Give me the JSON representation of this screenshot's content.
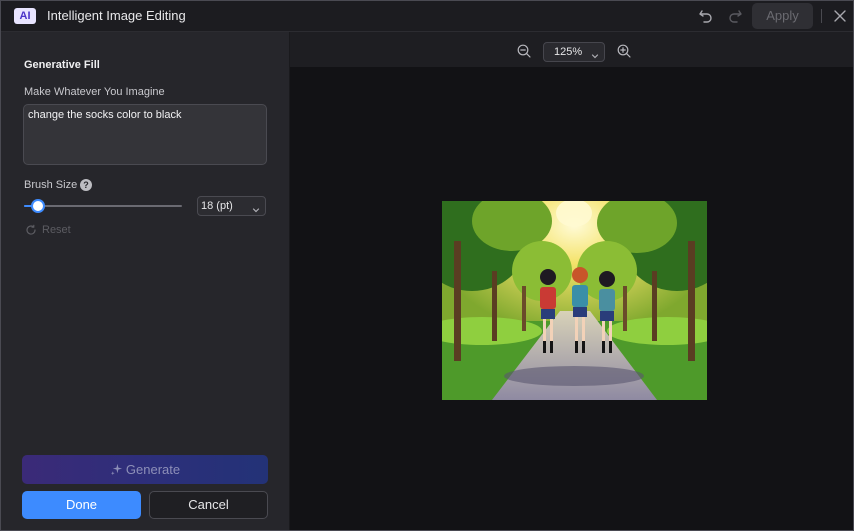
{
  "titlebar": {
    "badge": "AI",
    "title": "Intelligent Image Editing",
    "apply_label": "Apply",
    "icons": [
      "undo-icon",
      "redo-icon",
      "close-icon"
    ]
  },
  "panel": {
    "section_title": "Generative Fill",
    "prompt_label": "Make Whatever You Imagine",
    "prompt_value": "change the socks color to black",
    "brush_label": "Brush Size",
    "help_glyph": "?",
    "brush_level_fraction": 0.09,
    "brush_size_value": "18 (pt)",
    "reset_label": "Reset",
    "generate_label": "Generate",
    "done_label": "Done",
    "cancel_label": "Cancel"
  },
  "canvas": {
    "zoom_value": "125%"
  },
  "colors": {
    "accent": "#3d8bff",
    "generate_gradient_start": "#3b2a78",
    "generate_gradient_end": "#233277",
    "panel_bg": "#26262b",
    "canvas_bg": "#121215"
  }
}
